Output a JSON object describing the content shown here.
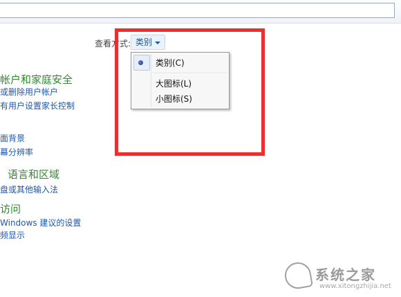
{
  "view_by": {
    "label": "查看方式:",
    "selected": "类别"
  },
  "menu": {
    "items": [
      "类别(C)",
      "大图标(L)",
      "小图标(S)"
    ],
    "selected_index": 0
  },
  "categories": [
    {
      "title": "帐户和家庭安全",
      "links": [
        "或删除用户帐户",
        "有用户设置家长控制"
      ]
    },
    {
      "title": "",
      "links": [
        "面背景",
        "幕分辨率"
      ]
    },
    {
      "title": "语言和区域",
      "links": [
        "盘或其他输入法"
      ]
    },
    {
      "title": "访问",
      "links": [
        "Windows 建议的设置",
        "频显示"
      ]
    }
  ],
  "watermark": {
    "text": "系统之家",
    "url": "www.xitongzhijia.net"
  },
  "highlight_color": "#ee2e2e"
}
